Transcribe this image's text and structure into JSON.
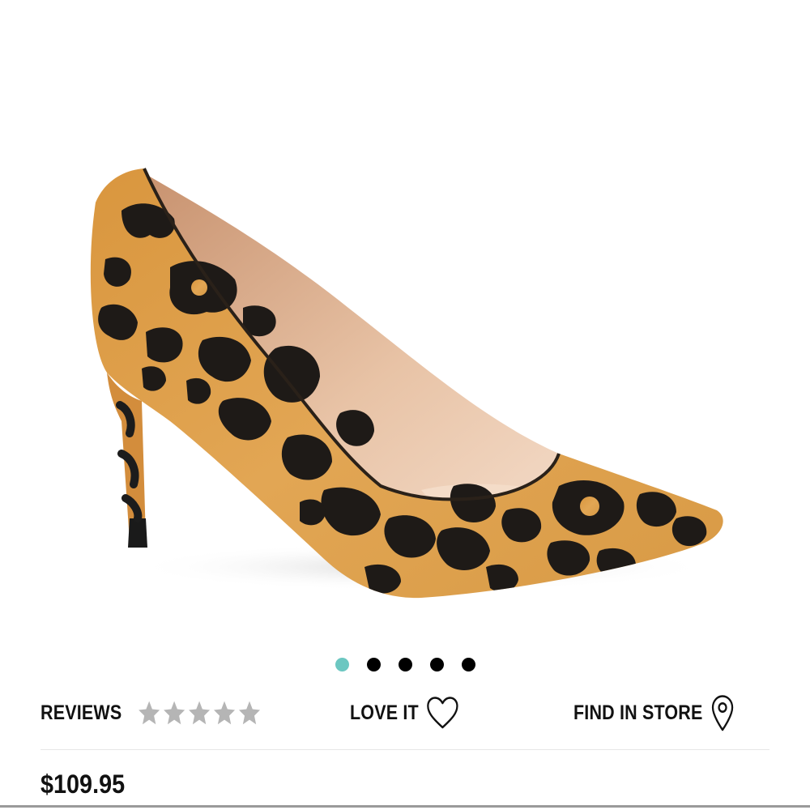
{
  "product": {
    "image_alt": "leopard print pointed-toe pump",
    "price": "$109.95"
  },
  "carousel": {
    "count": 5,
    "active_index": 0,
    "active_color": "#6cc7c1",
    "inactive_color": "#000000"
  },
  "actions": {
    "reviews_label": "REVIEWS",
    "rating": 0,
    "max_rating": 5,
    "star_color": "#b5b5b5",
    "love_label": "LOVE IT",
    "love_icon": "heart-outline-icon",
    "find_label": "FIND IN STORE",
    "find_icon": "map-pin-icon"
  }
}
